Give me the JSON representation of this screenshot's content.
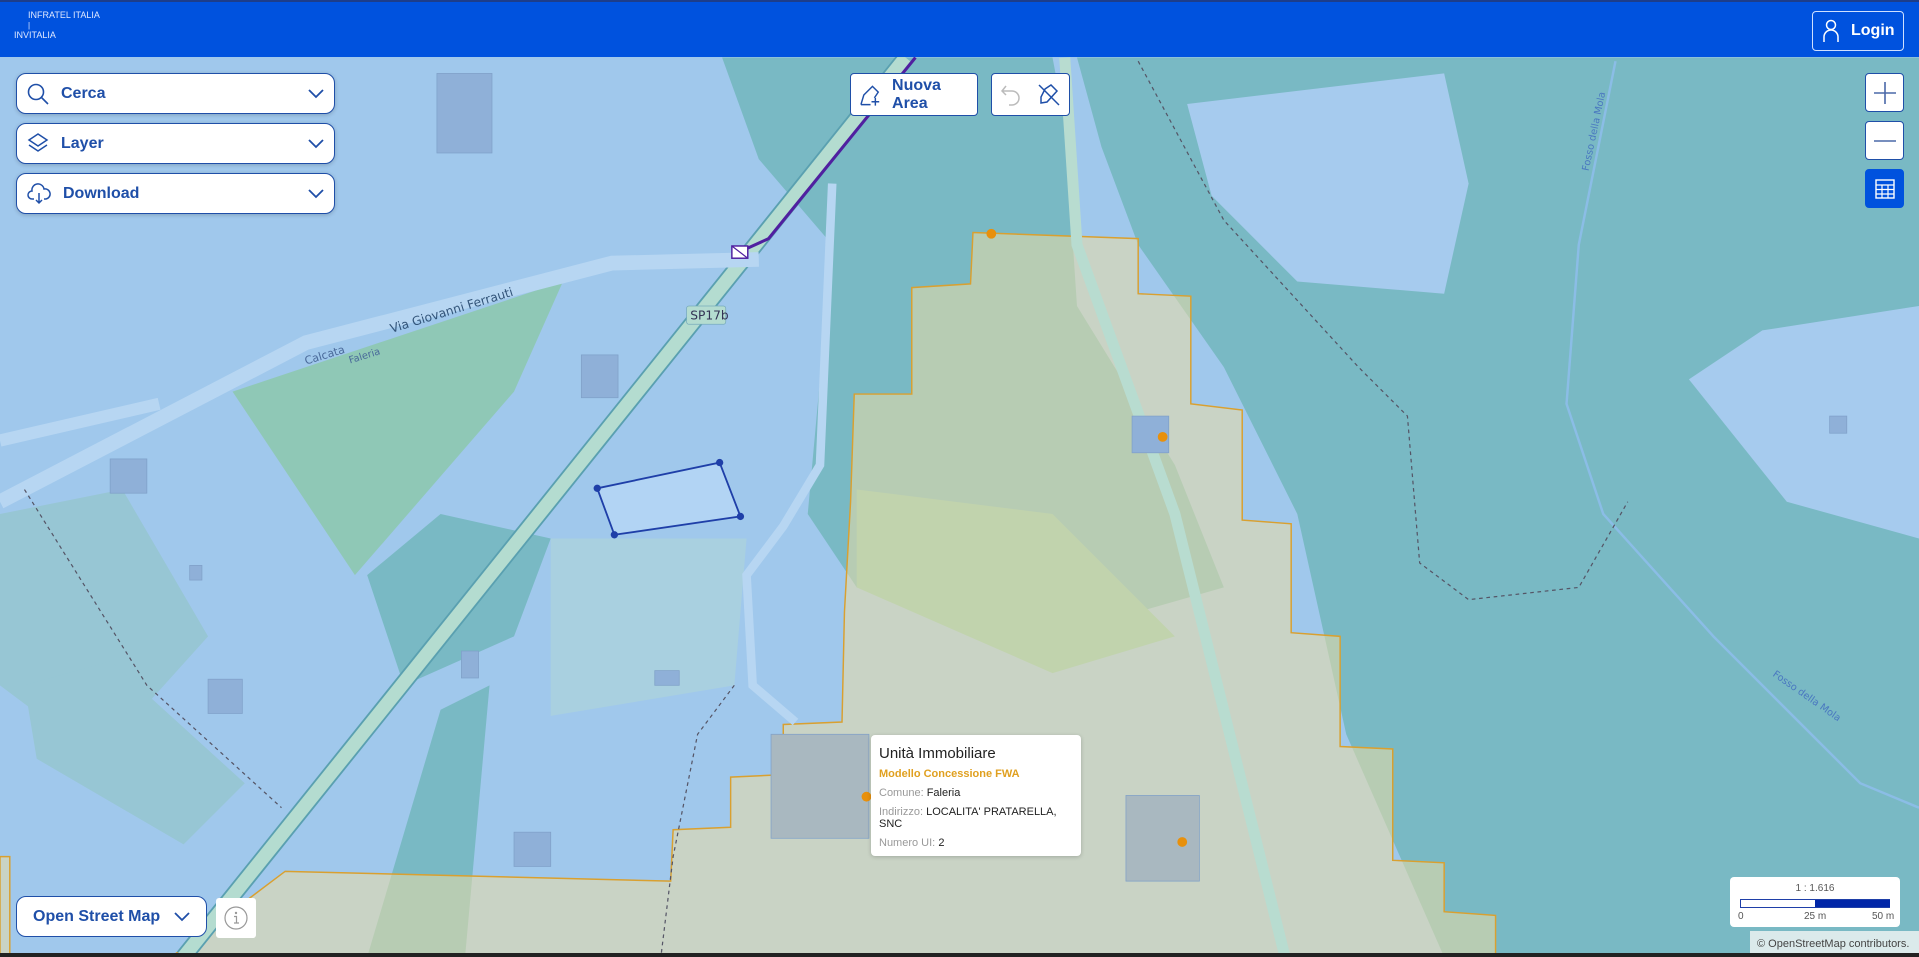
{
  "header": {
    "logo_line1": "INFRATEL ITALIA",
    "logo_line2": "INVITALIA",
    "logo_sep": "|",
    "login_label": "Login"
  },
  "panels": {
    "search_label": "Cerca",
    "layer_label": "Layer",
    "download_label": "Download"
  },
  "toolbar": {
    "new_area_label": "Nuova Area"
  },
  "map_labels": {
    "road1": "Via Giovanni Ferrauti",
    "calcata": "Calcata",
    "faleria": "Faleria",
    "sp": "SP17b",
    "fosso1": "Fosso della Mola",
    "fosso2": "Fosso della Mola"
  },
  "popup": {
    "title": "Unità Immobiliare",
    "subtitle": "Modello Concessione FWA",
    "rows": [
      {
        "key": "Comune:",
        "value": "Faleria"
      },
      {
        "key": "Indirizzo:",
        "value": "LOCALITA' PRATARELLA, SNC"
      },
      {
        "key": "Numero UI:",
        "value": "2"
      }
    ]
  },
  "basemap": {
    "selected": "Open Street Map"
  },
  "scale": {
    "ratio": "1 : 1.616",
    "ticks": [
      "0",
      "25 m",
      "50 m"
    ]
  },
  "attribution": "© OpenStreetMap contributors.",
  "colors": {
    "brand": "#0052de",
    "accent": "#1f4fa8",
    "orange": "#e0a020"
  }
}
